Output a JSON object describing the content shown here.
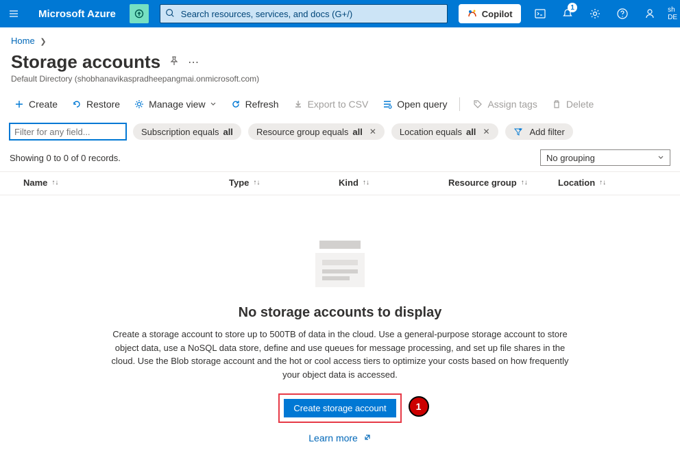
{
  "header": {
    "brand": "Microsoft Azure",
    "search_placeholder": "Search resources, services, and docs (G+/)",
    "copilot_label": "Copilot",
    "notification_count": "1",
    "user_line1": "sh",
    "user_line2": "DE"
  },
  "breadcrumb": {
    "items": [
      "Home"
    ]
  },
  "page": {
    "title": "Storage accounts",
    "subtitle": "Default Directory (shobhanavikaspradheepangmai.onmicrosoft.com)"
  },
  "commands": {
    "create": "Create",
    "restore": "Restore",
    "manage_view": "Manage view",
    "refresh": "Refresh",
    "export_csv": "Export to CSV",
    "open_query": "Open query",
    "assign_tags": "Assign tags",
    "delete": "Delete"
  },
  "filters": {
    "input_placeholder": "Filter for any field...",
    "subscription_prefix": "Subscription equals ",
    "subscription_value": "all",
    "rg_prefix": "Resource group equals ",
    "rg_value": "all",
    "location_prefix": "Location equals ",
    "location_value": "all",
    "add_filter": "Add filter"
  },
  "records": {
    "text": "Showing 0 to 0 of 0 records.",
    "grouping": "No grouping"
  },
  "columns": {
    "name": "Name",
    "type": "Type",
    "kind": "Kind",
    "resource_group": "Resource group",
    "location": "Location"
  },
  "empty": {
    "title": "No storage accounts to display",
    "description": "Create a storage account to store up to 500TB of data in the cloud. Use a general-purpose storage account to store object data, use a NoSQL data store, define and use queues for message processing, and set up file shares in the cloud. Use the Blob storage account and the hot or cool access tiers to optimize your costs based on how frequently your object data is accessed.",
    "button": "Create storage account",
    "learn_more": "Learn more",
    "callout": "1"
  }
}
